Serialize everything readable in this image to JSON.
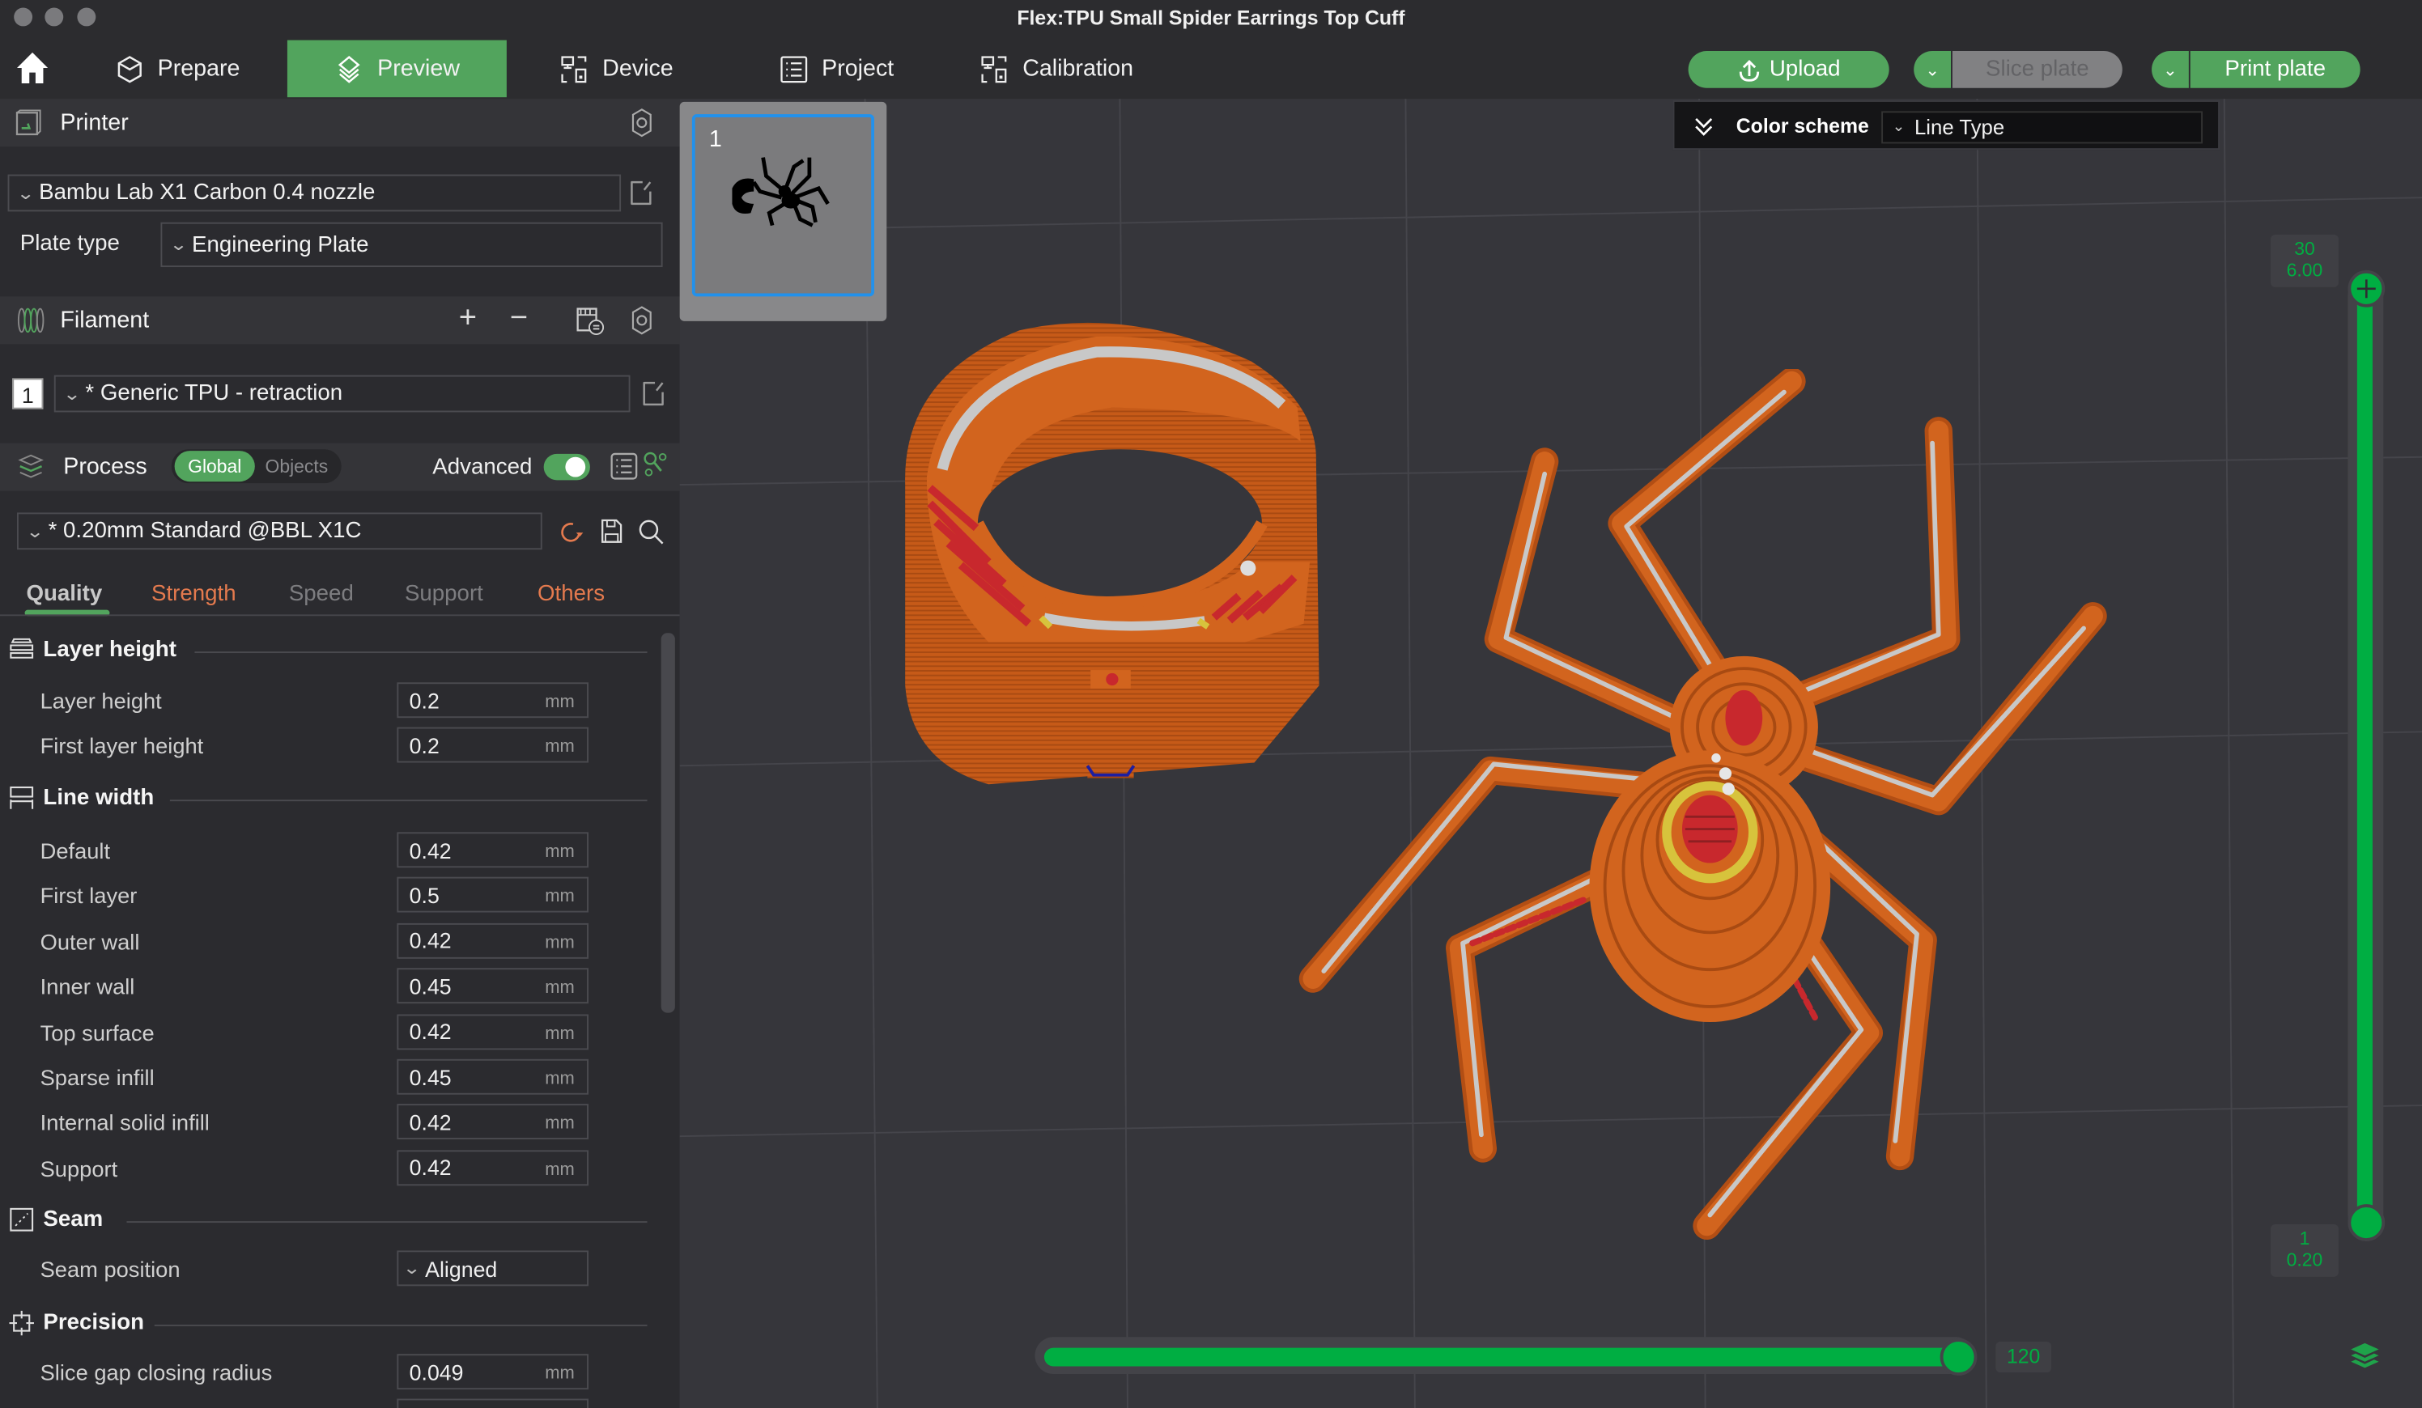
{
  "window": {
    "title": "Flex:TPU Small Spider Earrings Top Cuff"
  },
  "toolbar": {
    "home_icon": "home-icon",
    "tabs": [
      {
        "label": "Prepare",
        "icon": "prepare-cube-icon",
        "active": false
      },
      {
        "label": "Preview",
        "icon": "preview-layers-icon",
        "active": true
      },
      {
        "label": "Device",
        "icon": "device-icon",
        "active": false
      },
      {
        "label": "Project",
        "icon": "project-list-icon",
        "active": false
      },
      {
        "label": "Calibration",
        "icon": "calibration-icon",
        "active": false
      }
    ],
    "upload_label": "Upload",
    "slice_label": "Slice plate",
    "print_label": "Print plate",
    "accent": "#52a45d"
  },
  "sidebar": {
    "printer": {
      "title": "Printer",
      "printer_value": "Bambu Lab X1 Carbon 0.4 nozzle",
      "plate_type_label": "Plate type",
      "plate_type_value": "Engineering Plate"
    },
    "filament": {
      "title": "Filament",
      "slot_number": "1",
      "value": "* Generic TPU - retraction"
    },
    "process": {
      "title": "Process",
      "scope_options": [
        "Global",
        "Objects"
      ],
      "scope_selected": "Global",
      "advanced_label": "Advanced",
      "advanced_on": true,
      "preset_value": "* 0.20mm Standard @BBL X1C"
    },
    "category_tabs": [
      {
        "label": "Quality",
        "active": true,
        "color": "#c8c8c8"
      },
      {
        "label": "Strength",
        "active": false,
        "color": "#e47a4e"
      },
      {
        "label": "Speed",
        "active": false,
        "color": "#7d7d80"
      },
      {
        "label": "Support",
        "active": false,
        "color": "#7d7d80"
      },
      {
        "label": "Others",
        "active": false,
        "color": "#e47a4e"
      }
    ],
    "groups": {
      "layer_height": {
        "title": "Layer height",
        "rows": [
          {
            "label": "Layer height",
            "value": "0.2",
            "unit": "mm"
          },
          {
            "label": "First layer height",
            "value": "0.2",
            "unit": "mm"
          }
        ]
      },
      "line_width": {
        "title": "Line width",
        "rows": [
          {
            "label": "Default",
            "value": "0.42",
            "unit": "mm"
          },
          {
            "label": "First layer",
            "value": "0.5",
            "unit": "mm"
          },
          {
            "label": "Outer wall",
            "value": "0.42",
            "unit": "mm"
          },
          {
            "label": "Inner wall",
            "value": "0.45",
            "unit": "mm"
          },
          {
            "label": "Top surface",
            "value": "0.42",
            "unit": "mm"
          },
          {
            "label": "Sparse infill",
            "value": "0.45",
            "unit": "mm"
          },
          {
            "label": "Internal solid infill",
            "value": "0.42",
            "unit": "mm"
          },
          {
            "label": "Support",
            "value": "0.42",
            "unit": "mm"
          }
        ]
      },
      "seam": {
        "title": "Seam",
        "rows": [
          {
            "label": "Seam position",
            "value": "Aligned"
          }
        ]
      },
      "precision": {
        "title": "Precision",
        "rows": [
          {
            "label": "Slice gap closing radius",
            "value": "0.049",
            "unit": "mm"
          }
        ]
      }
    }
  },
  "viewport": {
    "plate_number": "1",
    "color_scheme_label": "Color scheme",
    "color_scheme_value": "Line Type",
    "layer_slider": {
      "top_layer": "30",
      "top_height": "6.00",
      "bottom_layer": "1",
      "bottom_height": "0.20"
    },
    "move_slider": {
      "value": "120",
      "fraction": 1.0
    },
    "model_colors": {
      "outer_wall": "#d2641e",
      "inner_wall": "#c8c8c8",
      "solid_infill": "#c8282d",
      "top_surface": "#d7c33c",
      "seam": "#1e1ea0"
    }
  }
}
